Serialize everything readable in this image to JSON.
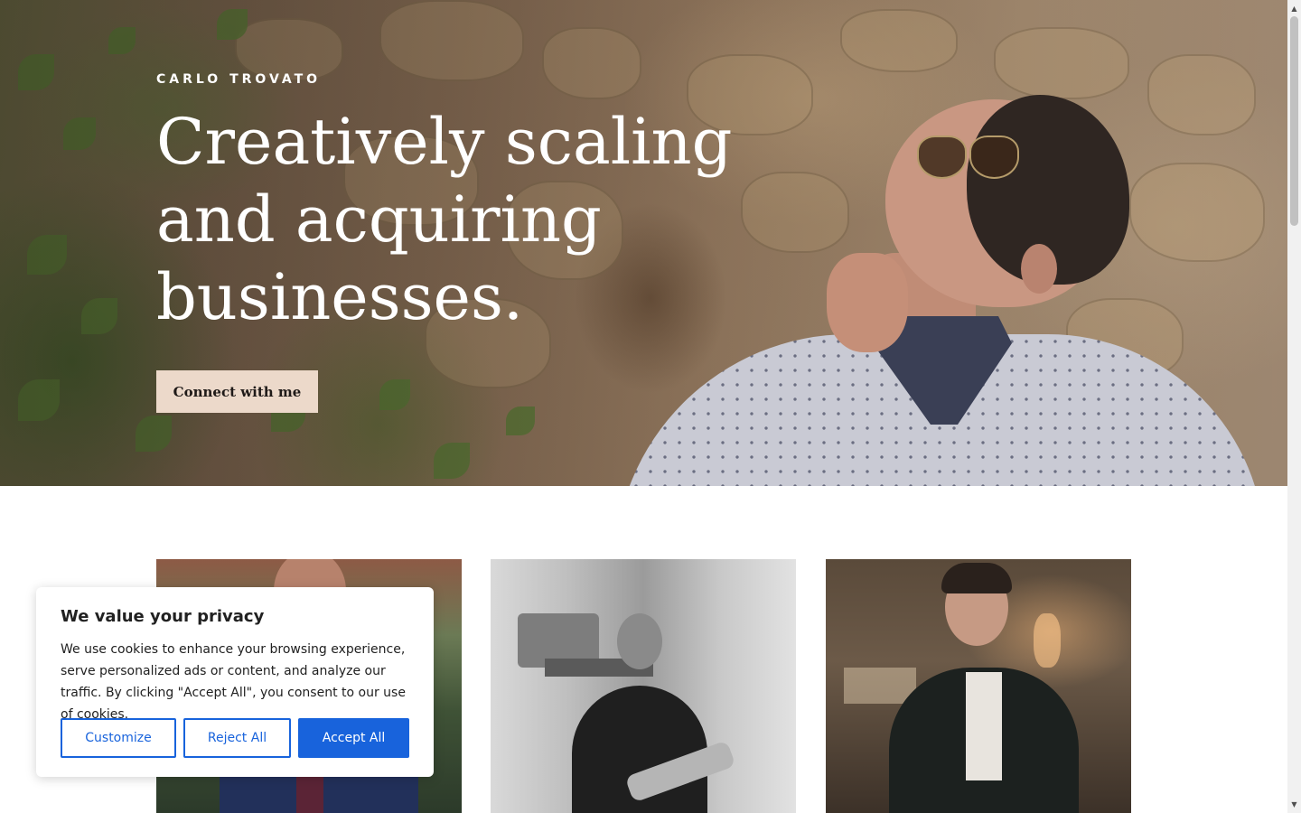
{
  "hero": {
    "brand": "CARLO TROVATO",
    "headline_lines": [
      "Creatively scaling",
      "and acquiring",
      "businesses."
    ],
    "cta_label": "Connect with me"
  },
  "gallery": {
    "photos": [
      "portrait-outdoor",
      "portrait-lounge-bw",
      "portrait-hotel-lobby"
    ]
  },
  "cookie_banner": {
    "title": "We value your privacy",
    "body": "We use cookies to enhance your browsing experience, serve personalized ads or content, and analyze our traffic. By clicking \"Accept All\", you consent to our use of cookies.",
    "buttons": {
      "customize": "Customize",
      "reject": "Reject All",
      "accept": "Accept All"
    }
  },
  "colors": {
    "accent": "#1863dc",
    "cta_bg": "#ecd9ca"
  },
  "scrollbar": {
    "up_arrow": "▲",
    "down_arrow": "▼"
  }
}
